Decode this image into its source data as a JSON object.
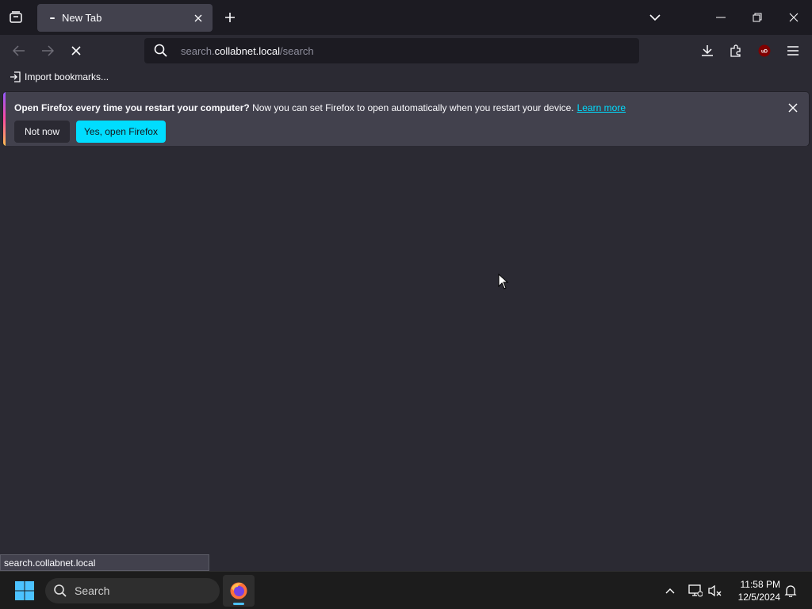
{
  "browser": {
    "tab": {
      "title": "New Tab"
    },
    "urlbar": {
      "prefix": "search.",
      "host": "collabnet.local",
      "path": "/search"
    },
    "bookmarks_toolbar": {
      "import_label": "Import bookmarks..."
    },
    "notification": {
      "bold_text": "Open Firefox every time you restart your computer?",
      "text": " Now you can set Firefox to open automatically when you restart your device.",
      "link": "Learn more",
      "not_now_label": "Not now",
      "yes_label": "Yes, open Firefox"
    },
    "status_text": "search.collabnet.local",
    "extension_badge": "uD"
  },
  "taskbar": {
    "search_label": "Search",
    "time": "11:58 PM",
    "date": "12/5/2024"
  },
  "colors": {
    "accent": "#00ddff",
    "chrome_dark": "#1c1b22",
    "content_bg": "#2b2a33",
    "tab_bg": "#42414d"
  }
}
